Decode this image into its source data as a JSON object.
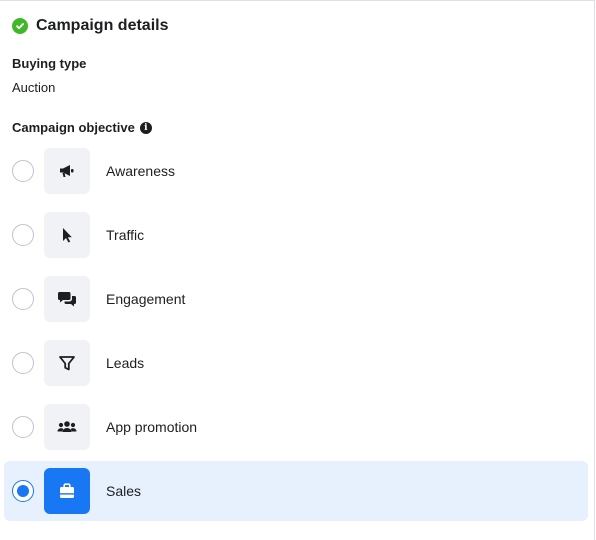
{
  "header": {
    "title": "Campaign details",
    "status_icon": "check-circle-icon",
    "status_color": "#42b72a"
  },
  "buying_type": {
    "label": "Buying type",
    "value": "Auction"
  },
  "objective": {
    "label": "Campaign objective",
    "info_icon": "info-icon",
    "options": [
      {
        "label": "Awareness",
        "icon": "megaphone-icon",
        "selected": false
      },
      {
        "label": "Traffic",
        "icon": "cursor-icon",
        "selected": false
      },
      {
        "label": "Engagement",
        "icon": "chat-bubbles-icon",
        "selected": false
      },
      {
        "label": "Leads",
        "icon": "funnel-icon",
        "selected": false
      },
      {
        "label": "App promotion",
        "icon": "people-icon",
        "selected": false
      },
      {
        "label": "Sales",
        "icon": "shopping-bag-icon",
        "selected": true
      }
    ]
  },
  "colors": {
    "accent": "#1877f2",
    "selected_bg": "#e7f0fd",
    "icon_bg": "#f0f2f5"
  }
}
